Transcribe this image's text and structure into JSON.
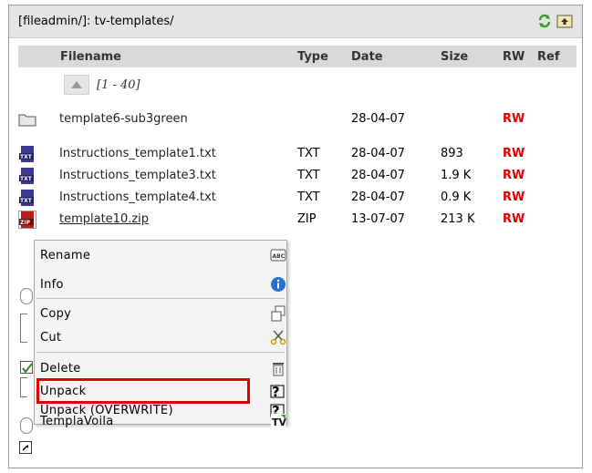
{
  "path": "[fileadmin/]: tv-templates/",
  "columns": {
    "filename": "Filename",
    "type": "Type",
    "date": "Date",
    "size": "Size",
    "rw": "RW",
    "ref": "Ref"
  },
  "range": "[1 - 40]",
  "rows": [
    {
      "icon": "folder-icon",
      "name": "template6-sub3green",
      "type": "",
      "date": "28-04-07",
      "size": "",
      "rw": "RW"
    },
    {
      "icon": "txt-file-icon",
      "name": "Instructions_template1.txt",
      "type": "TXT",
      "date": "28-04-07",
      "size": "893",
      "rw": "RW"
    },
    {
      "icon": "txt-file-icon",
      "name": "Instructions_template3.txt",
      "type": "TXT",
      "date": "28-04-07",
      "size": "1.9 K",
      "rw": "RW"
    },
    {
      "icon": "txt-file-icon",
      "name": "Instructions_template4.txt",
      "type": "TXT",
      "date": "28-04-07",
      "size": "0.9 K",
      "rw": "RW"
    },
    {
      "icon": "zip-file-icon",
      "name": "template10.zip",
      "type": "ZIP",
      "date": "13-07-07",
      "size": "213 K",
      "rw": "RW"
    }
  ],
  "context_menu": {
    "items": [
      {
        "label": "Rename",
        "icon": "rename-icon"
      },
      {
        "label": "Info",
        "icon": "info-icon"
      },
      {
        "label": "Copy",
        "icon": "copy-icon"
      },
      {
        "label": "Cut",
        "icon": "cut-icon"
      },
      {
        "label": "Delete",
        "icon": "delete-icon"
      },
      {
        "label": "Unpack",
        "icon": "unpack-icon"
      },
      {
        "label": "Unpack (OVERWRITE)",
        "icon": "unpack-icon"
      },
      {
        "label": "TemplaVoila",
        "icon": "templavoila-icon"
      }
    ]
  },
  "colors": {
    "rw": "#e00000",
    "highlight": "#e00000",
    "header_bg": "#d9d9d9",
    "pathbar_bg": "#e4e4e4"
  }
}
